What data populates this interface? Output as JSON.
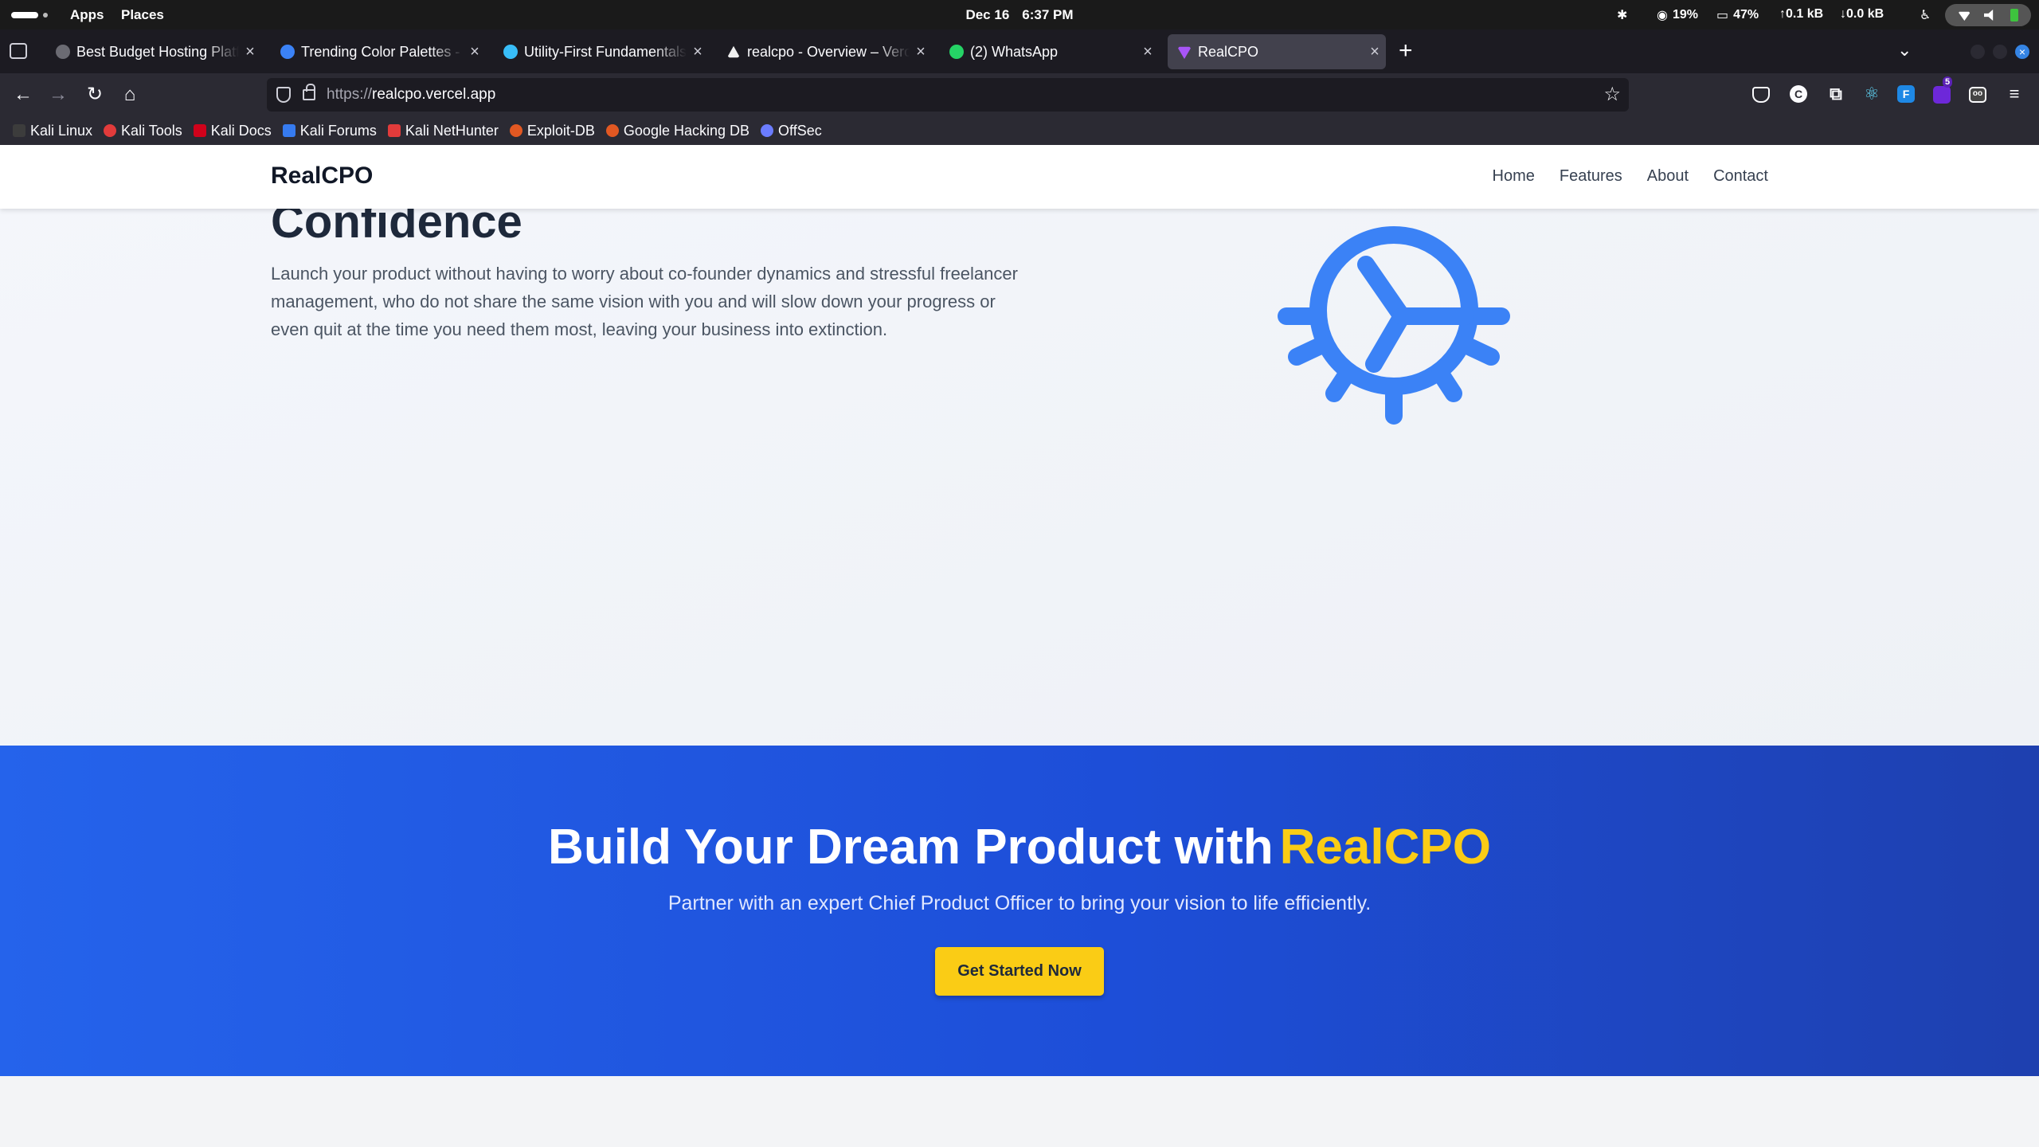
{
  "topbar": {
    "apps": "Apps",
    "places": "Places",
    "date": "Dec 16",
    "time": "6:37 PM",
    "cpu": "19%",
    "mem": "47%",
    "net_up": "↑0.1 kB",
    "net_down": "↓0.0 kB"
  },
  "tabs": [
    {
      "title": "Best Budget Hosting Platf",
      "color": "#6b6b73"
    },
    {
      "title": "Trending Color Palettes -",
      "color": "#3b82f6"
    },
    {
      "title": "Utility-First Fundamentals",
      "color": "#38bdf8"
    },
    {
      "title": "realcpo - Overview – Verce",
      "color": "#000000"
    },
    {
      "title": "(2) WhatsApp",
      "color": "#25d366"
    },
    {
      "title": "RealCPO",
      "color": "#a855f7",
      "active": true
    }
  ],
  "address": {
    "scheme": "https://",
    "host": "realcpo.vercel.app"
  },
  "bookmarks": [
    {
      "label": "Kali Linux",
      "color": "#2d2d2d"
    },
    {
      "label": "Kali Tools",
      "color": "#e23b3b"
    },
    {
      "label": "Kali Docs",
      "color": "#d0021b"
    },
    {
      "label": "Kali Forums",
      "color": "#367bf0"
    },
    {
      "label": "Kali NetHunter",
      "color": "#e23b3b"
    },
    {
      "label": "Exploit-DB",
      "color": "#e25822"
    },
    {
      "label": "Google Hacking DB",
      "color": "#e25822"
    },
    {
      "label": "OffSec",
      "color": "#6b7cff"
    }
  ],
  "extensions": {
    "badge_count": "5"
  },
  "site": {
    "brand": "RealCPO",
    "nav": [
      "Home",
      "Features",
      "About",
      "Contact"
    ]
  },
  "hero": {
    "heading": "Confidence",
    "text": "Launch your product without having to worry about co-founder dynamics and stressful freelancer management, who do not share the same vision with you and will slow down your progress or even quit at the time you need them most, leaving your business into extinction."
  },
  "cta": {
    "title": "Build Your Dream Product with",
    "title_accent": "RealCPO",
    "subtitle": "Partner with an expert Chief Product Officer to bring your vision to life efficiently.",
    "button": "Get Started Now"
  },
  "colors": {
    "brand_blue": "#2563eb",
    "accent_yellow": "#facc15",
    "gear_blue": "#3b82f6"
  }
}
